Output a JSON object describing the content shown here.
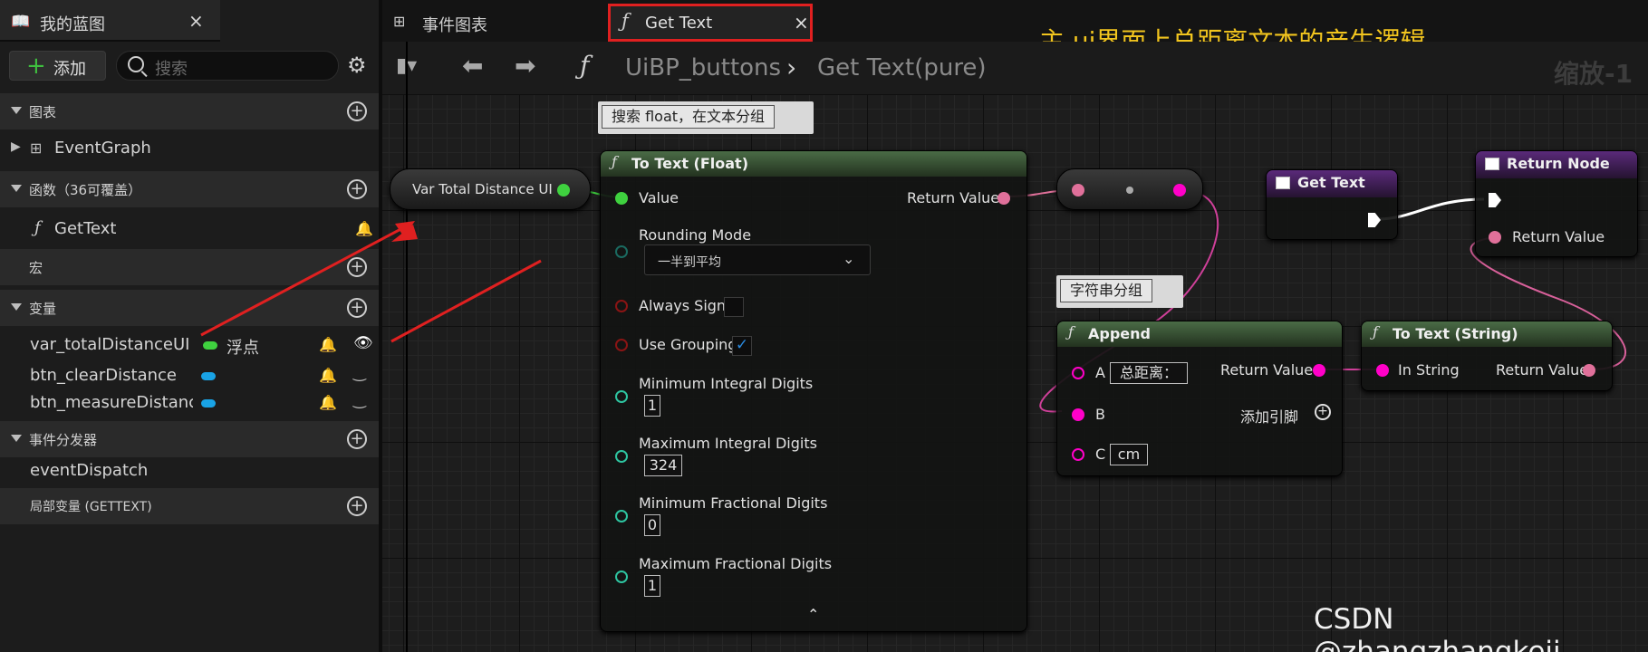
{
  "panel": {
    "tab_title": "我的蓝图",
    "add_label": "添加",
    "search_placeholder": "搜索",
    "sections": {
      "graphs": "图表",
      "event_graph": "EventGraph",
      "functions": "函数（36可覆盖）",
      "get_text": "GetText",
      "macros": "宏",
      "variables": "变量",
      "dispatchers": "事件分发器",
      "event_dispatch": "eventDispatch",
      "local_vars": "局部变量 (GETTEXT)"
    },
    "variables": [
      {
        "name": "var_totalDistanceUI",
        "type": "浮点",
        "color": "#3fd13f"
      },
      {
        "name": "btn_clearDistance",
        "type": "",
        "color": "#19a3e6"
      },
      {
        "name": "btn_measureDistanc",
        "type": "",
        "color": "#19a3e6"
      }
    ]
  },
  "tabs": {
    "event_graph": "事件图表",
    "get_text": "Get Text"
  },
  "breadcrumb": {
    "root": "UiBP_buttons",
    "current": "Get Text(pure)",
    "zoom": "缩放-1"
  },
  "annotation": "主 ui界面上总距离文本的产生逻辑",
  "graph": {
    "var_node": "Var Total Distance UI",
    "to_text_float": {
      "title": "To Text (Float)",
      "value": "Value",
      "return_value": "Return Value",
      "rounding_mode": "Rounding Mode",
      "rounding_value": "一半到平均",
      "always_sign": "Always Sign",
      "use_grouping": "Use Grouping",
      "min_integral": "Minimum Integral Digits",
      "min_integral_val": "1",
      "max_integral": "Maximum Integral Digits",
      "max_integral_val": "324",
      "min_fractional": "Minimum Fractional Digits",
      "min_fractional_val": "0",
      "max_fractional": "Maximum Fractional Digits",
      "max_fractional_val": "1"
    },
    "comment_float": "搜索 float，在文本分组",
    "comment_string": "字符串分组",
    "get_text_node": "Get Text",
    "return_node": {
      "title": "Return Node",
      "return_value": "Return Value"
    },
    "append": {
      "title": "Append",
      "a": "A",
      "a_val": "总距离：",
      "b": "B",
      "c": "C",
      "c_val": "cm",
      "return_value": "Return Value",
      "add_pin": "添加引脚"
    },
    "to_text_string": {
      "title": "To Text (String)",
      "in_string": "In String",
      "return_value": "Return Value"
    }
  },
  "watermark": "CSDN @zhangzhangkeji",
  "colors": {
    "float_pin": "#3fd13f",
    "text_pin": "#e0709a",
    "string_pin": "#ff00c8",
    "bool_pin": "#8a1414",
    "int_pin": "#2ec4a0",
    "byte_pin": "#1a6a60",
    "highlight": "#e02020",
    "note": "#f2c51e"
  }
}
